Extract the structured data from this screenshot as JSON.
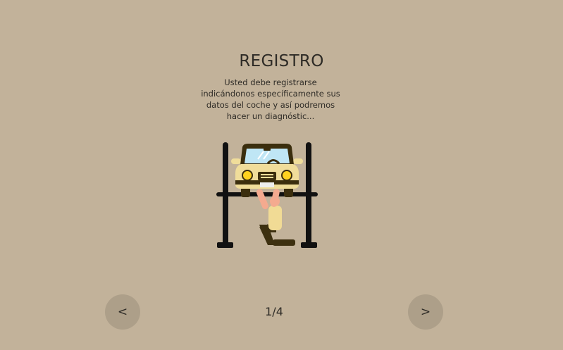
{
  "slide": {
    "title": "REGISTRO",
    "description": "Usted debe registrarse indicándonos específicamente sus datos del coche y así podremos hacer un diagnóstic...",
    "illustration": "mechanic-under-car-lift-icon"
  },
  "navigation": {
    "prev_label": "<",
    "next_label": ">",
    "page_indicator": "1/4"
  },
  "colors": {
    "background": "#c2b29a",
    "button": "#ad9f89",
    "text": "#2e2b26",
    "car": "#f0dd9a",
    "headlight": "#ffd21f",
    "windshield": "#bfe6f5",
    "lift": "#111111"
  }
}
